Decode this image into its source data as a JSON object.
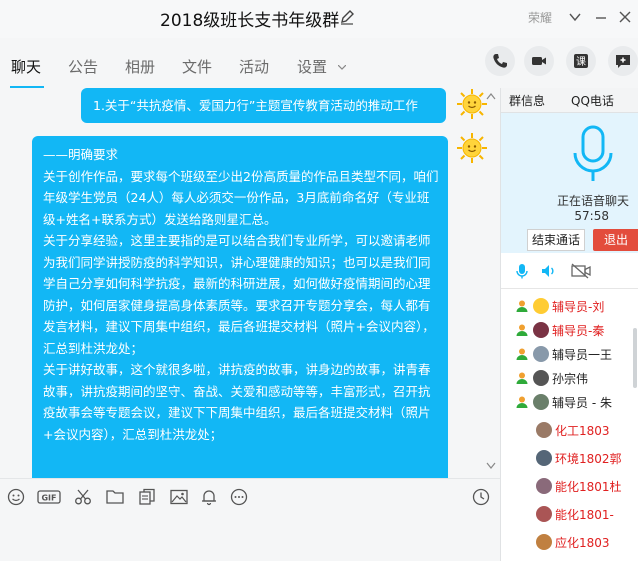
{
  "window": {
    "title": "2018级班长支书年级群",
    "label_partial": "荣耀"
  },
  "nav": {
    "tabs": [
      "聊天",
      "公告",
      "相册",
      "文件",
      "活动",
      "设置"
    ]
  },
  "chat": {
    "message1": "1.关于“共抗疫情、爱国力行”主题宣传教育活动的推动工作",
    "message2": [
      "——明确要求",
      "关于创作作品，要求每个班级至少出2份高质量的作品且类型不同，咱们年级学生党员（24人）每人必须交一份作品，3月底前命名好（专业班级+姓名+联系方式）发送给路则星汇总。",
      "关于分享经验，这里主要指的是可以结合我们专业所学，可以邀请老师为我们同学讲授防疫的科学知识，讲心理健康的知识；也可以是我们同学自己分享如何科学抗疫，最新的科研进展，如何做好疫情期间的心理防护，如何居家健身提高身体素质等。要求召开专题分享会，每人都有发言材料，建议下周集中组织，最后各班提交材料（照片+会议内容），汇总到杜洪龙处；",
      "关于讲好故事，这个就很多啦，讲抗疫的故事，讲身边的故事，讲青春故事，讲抗疫期间的坚守、奋战、关爱和感动等等，丰富形式，召开抗疫故事会等专题会议，建议下下周集中组织，最后各班提交材料（照片+会议内容），汇总到杜洪龙处；"
    ]
  },
  "toolbar": {
    "icons": [
      "emoji-icon",
      "gif-icon",
      "scissors-icon",
      "folder-icon",
      "document-icon",
      "image-icon",
      "bell-icon",
      "more-icon",
      "history-icon"
    ]
  },
  "right_panel": {
    "tabs": [
      "群信息",
      "QQ电话"
    ],
    "call_status": "正在语音聊天",
    "call_timer": "57:58",
    "end_call": "结束通话",
    "exit": "退出",
    "members": [
      {
        "name": "辅导员-刘",
        "color": "#e02020",
        "indent": false
      },
      {
        "name": "辅导员-秦",
        "color": "#e02020",
        "indent": false
      },
      {
        "name": "辅导员一王",
        "color": "#222222",
        "indent": false
      },
      {
        "name": "孙宗伟",
        "color": "#222222",
        "indent": false
      },
      {
        "name": "辅导员 - 朱",
        "color": "#222222",
        "indent": false
      },
      {
        "name": "化工1803",
        "color": "#e02020",
        "indent": true
      },
      {
        "name": "环境1802郭",
        "color": "#e02020",
        "indent": true
      },
      {
        "name": "能化1801杜",
        "color": "#e02020",
        "indent": true
      },
      {
        "name": "能化1801-",
        "color": "#e02020",
        "indent": true
      },
      {
        "name": "应化1803",
        "color": "#e02020",
        "indent": true
      }
    ]
  },
  "colors": {
    "accent": "#12b7f5",
    "exit_red": "#e34c3c",
    "name_red": "#e02020"
  }
}
